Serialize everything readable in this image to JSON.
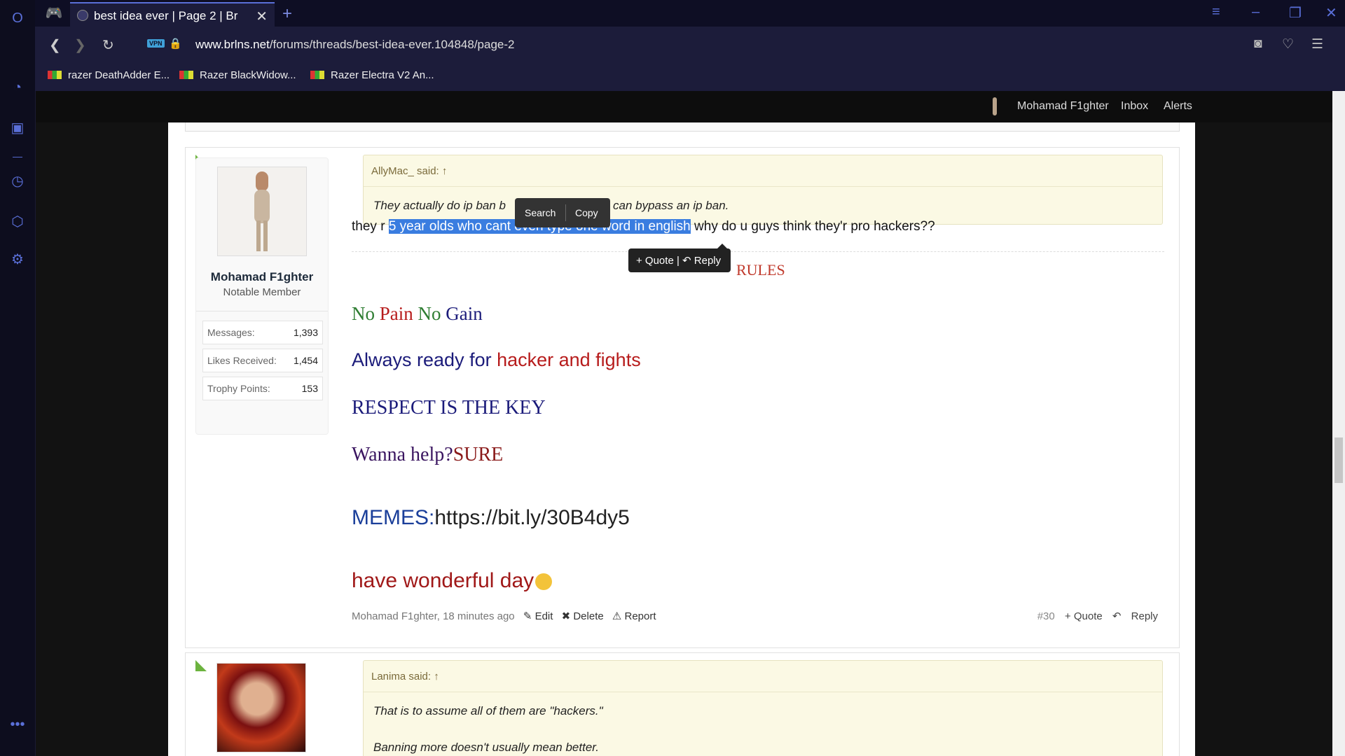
{
  "browser": {
    "tab_title": "best idea ever | Page 2 | Br",
    "url_domain": "www.brlns.net",
    "url_path": "/forums/threads/best-idea-ever.104848/page-2",
    "vpn_label": "VPN",
    "bookmarks": [
      "razer DeathAdder E...",
      "Razer BlackWidow...",
      "Razer Electra V2 An..."
    ]
  },
  "sitenav": {
    "username": "Mohamad F1ghter",
    "inbox": "Inbox",
    "alerts": "Alerts"
  },
  "post1": {
    "username": "Mohamad F1ghter",
    "user_title": "Notable Member",
    "stats": [
      {
        "label": "Messages:",
        "value": "1,393"
      },
      {
        "label": "Likes Received:",
        "value": "1,454"
      },
      {
        "label": "Trophy Points:",
        "value": "153"
      }
    ],
    "quote_author": "AllyMac_ said:",
    "quote_text_left": "They actually do ip ban b",
    "quote_text_right": "can bypass an ip ban.",
    "message_pre": "they r ",
    "message_selected": "5 year olds who cant even type one word in english",
    "message_post": " why do u guys think they'r pro hackers??",
    "sig_rules": "RULES",
    "sig_no1": "No ",
    "sig_pain": "Pain ",
    "sig_no2": "No ",
    "sig_gain": "Gain",
    "sig_always": "Always ready for ",
    "sig_hacker": "hacker and fights",
    "sig_respect": "RESPECT IS THE KEY",
    "sig_wanna": "Wanna help?",
    "sig_sure": "SURE",
    "sig_memes": "MEMES:",
    "sig_memes_link": "https://bit.ly/30B4dy5",
    "sig_day": "have wonderful day",
    "meta_author_time": "Mohamad F1ghter, 18 minutes ago",
    "edit": "Edit",
    "delete": "Delete",
    "report": "Report",
    "post_number": "#30",
    "quote": "+ Quote",
    "reply": "Reply"
  },
  "post2": {
    "quote_author": "Lanima said:",
    "quote_line1": "That is to assume all of them are \"hackers.\"",
    "quote_line2": "Banning more doesn't usually mean better."
  },
  "context_menu": {
    "search": "Search",
    "copy": "Copy"
  },
  "quote_reply_popup": {
    "quote": "+ Quote",
    "reply": "Reply"
  },
  "colors": {
    "accent": "#5a6fd8",
    "selection": "#3a7de0",
    "sig_red": "#a01818",
    "sig_blue": "#1b1b7a",
    "sig_green": "#2e7d32"
  }
}
